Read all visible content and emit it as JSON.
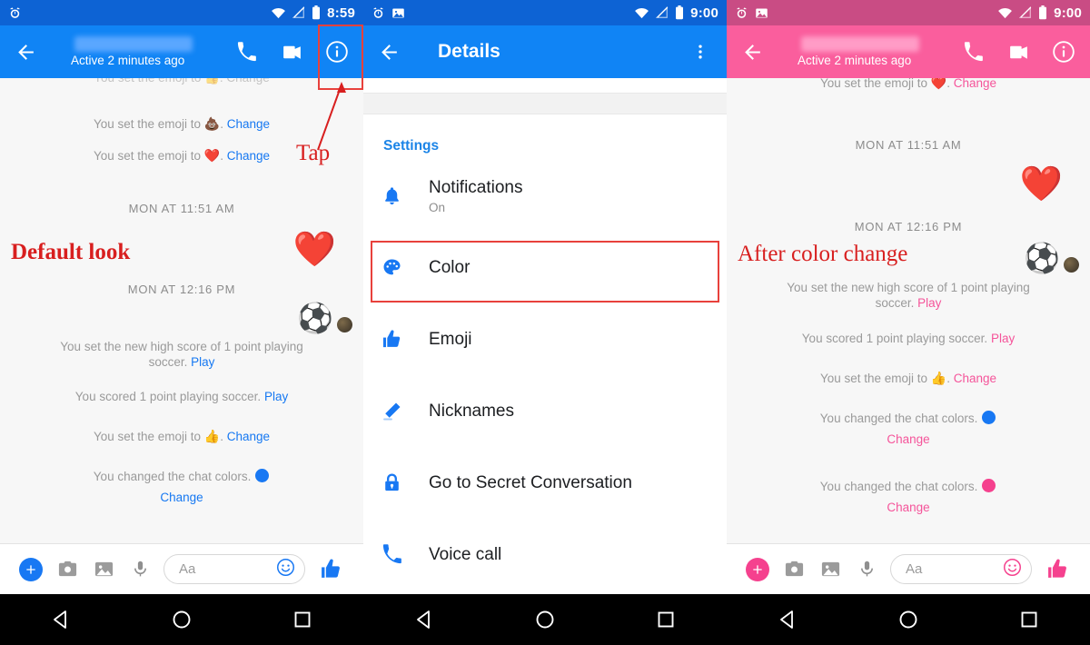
{
  "panels": {
    "left": {
      "theme": {
        "status_bar": "#0d63d4",
        "toolbar": "#1084f5",
        "accent": "#1678f2"
      },
      "status": {
        "time": "8:59",
        "icons": [
          "alarm-icon",
          "wifi-icon",
          "signal-off-icon",
          "battery-icon"
        ]
      },
      "toolbar": {
        "subtitle": "Active 2 minutes ago",
        "actions": [
          "phone-icon",
          "video-icon",
          "info-icon"
        ]
      },
      "messages": [
        {
          "type": "system-cut",
          "text": "You set the emoji to 👍. Change"
        },
        {
          "type": "system",
          "prefix": "You set the emoji to ",
          "emoji": "💩",
          "suffix": ". ",
          "link": "Change"
        },
        {
          "type": "system",
          "prefix": "You set the emoji to ",
          "emoji": "❤️",
          "suffix": ". ",
          "link": "Change"
        },
        {
          "type": "timestamp",
          "text": "MON AT 11:51 AM"
        },
        {
          "type": "sticker",
          "emoji": "❤️"
        },
        {
          "type": "timestamp",
          "text": "MON AT 12:16 PM"
        },
        {
          "type": "game",
          "ball": "⚽",
          "avatar": "avatar-thumb"
        },
        {
          "type": "system",
          "prefix": "You set the new high score of 1 point playing soccer. ",
          "link": "Play"
        },
        {
          "type": "system",
          "prefix": "You scored 1 point playing soccer. ",
          "link": "Play"
        },
        {
          "type": "system",
          "prefix": "You set the emoji to ",
          "emoji": "👍",
          "suffix": ". ",
          "link": "Change"
        },
        {
          "type": "color",
          "prefix": "You changed the chat colors. ",
          "swatch": "#1878f3",
          "link": "Change"
        }
      ],
      "annotations": [
        {
          "name": "default-look-label",
          "text": "Default look"
        },
        {
          "name": "tap-label",
          "text": "Tap"
        }
      ],
      "composer": {
        "plus": "plus-icon",
        "camera": "camera-icon",
        "gallery": "gallery-icon",
        "mic": "microphone-icon",
        "placeholder": "Aa",
        "value": "",
        "smiley": "smiley-icon",
        "thumb": "thumbs-up-icon"
      },
      "nav": {
        "back": "nav-back-icon",
        "home": "nav-home-icon",
        "recents": "nav-recents-icon"
      }
    },
    "middle": {
      "theme": {
        "status_bar": "#0d63d4",
        "toolbar": "#1084f5"
      },
      "status": {
        "time": "9:00",
        "icons": [
          "alarm-icon",
          "image-icon",
          "wifi-icon",
          "signal-off-icon",
          "battery-icon"
        ]
      },
      "toolbar": {
        "title": "Details",
        "overflow": "more-vert-icon"
      },
      "section_title": "Settings",
      "rows": [
        {
          "icon": "bell-icon",
          "label": "Notifications",
          "sub": "On",
          "highlighted": false
        },
        {
          "icon": "palette-icon",
          "label": "Color",
          "sub": "",
          "highlighted": true
        },
        {
          "icon": "thumbs-up-icon",
          "label": "Emoji",
          "sub": "",
          "highlighted": false
        },
        {
          "icon": "pencil-icon",
          "label": "Nicknames",
          "sub": "",
          "highlighted": false
        },
        {
          "icon": "lock-icon",
          "label": "Go to Secret Conversation",
          "sub": "",
          "highlighted": false
        },
        {
          "icon": "phone-icon",
          "label": "Voice call",
          "sub": "",
          "highlighted": false
        }
      ],
      "nav": {
        "back": "nav-back-icon",
        "home": "nav-home-icon",
        "recents": "nav-recents-icon"
      }
    },
    "right": {
      "theme": {
        "status_bar": "#c94c84",
        "toolbar": "#fa5e9d",
        "accent": "#f5549a"
      },
      "status": {
        "time": "9:00",
        "icons": [
          "alarm-icon",
          "image-icon",
          "wifi-icon",
          "signal-off-icon",
          "battery-icon"
        ]
      },
      "toolbar": {
        "subtitle": "Active 2 minutes ago",
        "actions": [
          "phone-icon",
          "video-icon",
          "info-icon"
        ]
      },
      "messages": [
        {
          "type": "system-cut",
          "prefix": "You set the emoji to ",
          "emoji": "❤️",
          "suffix": ". ",
          "link": "Change"
        },
        {
          "type": "timestamp",
          "text": "MON AT 11:51 AM"
        },
        {
          "type": "sticker",
          "emoji": "❤️"
        },
        {
          "type": "timestamp",
          "text": "MON AT 12:16 PM"
        },
        {
          "type": "game",
          "ball": "⚽",
          "avatar": "avatar-thumb"
        },
        {
          "type": "system",
          "prefix": "You set the new high score of 1 point playing soccer. ",
          "link": "Play"
        },
        {
          "type": "system",
          "prefix": "You scored 1 point playing soccer. ",
          "link": "Play"
        },
        {
          "type": "system",
          "prefix": "You set the emoji to ",
          "emoji": "👍",
          "suffix": ". ",
          "link": "Change"
        },
        {
          "type": "color",
          "prefix": "You changed the chat colors. ",
          "swatch": "#1878f3",
          "link": "Change"
        },
        {
          "type": "color",
          "prefix": "You changed the chat colors. ",
          "swatch": "#f5418e",
          "link": "Change"
        }
      ],
      "annotations": [
        {
          "name": "after-color-change-label",
          "text": "After color change"
        }
      ],
      "composer": {
        "plus": "plus-icon",
        "camera": "camera-icon",
        "gallery": "gallery-icon",
        "mic": "microphone-icon",
        "placeholder": "Aa",
        "value": "",
        "smiley": "smiley-icon",
        "thumb": "thumbs-up-icon"
      },
      "nav": {
        "back": "nav-back-icon",
        "home": "nav-home-icon",
        "recents": "nav-recents-icon"
      }
    }
  },
  "text": {
    "l_cut": "You set the emoji to 👍. Change",
    "l_m1_a": "You set the emoji to ",
    "l_m1_e": "💩",
    "l_m1_b": ". ",
    "l_m1_link": "Change",
    "l_m2_a": "You set the emoji to ",
    "l_m2_e": "❤️",
    "l_m2_b": ". ",
    "l_m2_link": "Change",
    "l_ts1": "MON AT 11:51 AM",
    "l_ts2": "MON AT 12:16 PM",
    "l_heart": "❤️",
    "l_ball": "⚽",
    "l_hs_a": "You set the new high score of 1 point playing",
    "l_hs_b": "soccer. ",
    "l_hs_link": "Play",
    "l_sc_a": "You scored 1 point playing soccer. ",
    "l_sc_link": "Play",
    "l_em_a": "You set the emoji to ",
    "l_em_e": "👍",
    "l_em_b": ". ",
    "l_em_link": "Change",
    "l_cc_a": "You changed the chat colors. ",
    "l_cc_link": "Change",
    "l_annot_default": "Default look",
    "l_annot_tap": "Tap",
    "r_cut_a": "You set the emoji to ",
    "r_cut_e": "❤️",
    "r_cut_b": ". ",
    "r_cut_link": "Change",
    "r_ts1": "MON AT 11:51 AM",
    "r_ts2": "MON AT 12:16 PM",
    "r_heart": "❤️",
    "r_ball": "⚽",
    "r_hs_a": "You set the new high score of 1 point playing",
    "r_hs_b": "soccer. ",
    "r_hs_link": "Play",
    "r_sc_a": "You scored 1 point playing soccer. ",
    "r_sc_link": "Play",
    "r_em_a": "You set the emoji to ",
    "r_em_e": "👍",
    "r_em_b": ". ",
    "r_em_link": "Change",
    "r_cc1_a": "You changed the chat colors. ",
    "r_cc1_link": "Change",
    "r_cc2_a": "You changed the chat colors. ",
    "r_cc2_link": "Change",
    "r_annot": "After color change"
  }
}
